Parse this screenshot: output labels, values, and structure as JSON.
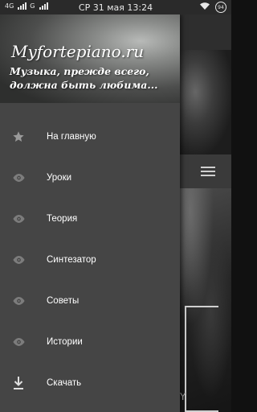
{
  "status_bar": {
    "network_left": "4G",
    "network_right": "G",
    "time": "СР 31 мая 13:24",
    "battery_level": "94"
  },
  "drawer": {
    "header": {
      "title": "Myfortepiano.ru",
      "tagline": "Музыка, прежде всего, должна быть любима..."
    },
    "items": [
      {
        "label": "На главную",
        "icon": "star-icon"
      },
      {
        "label": "Уроки",
        "icon": "eye-icon"
      },
      {
        "label": "Теория",
        "icon": "eye-icon"
      },
      {
        "label": "Синтезатор",
        "icon": "eye-icon"
      },
      {
        "label": "Советы",
        "icon": "eye-icon"
      },
      {
        "label": "Истории",
        "icon": "eye-icon"
      },
      {
        "label": "Скачать",
        "icon": "download-icon"
      }
    ]
  },
  "background_page": {
    "partial_letter": "Y"
  }
}
